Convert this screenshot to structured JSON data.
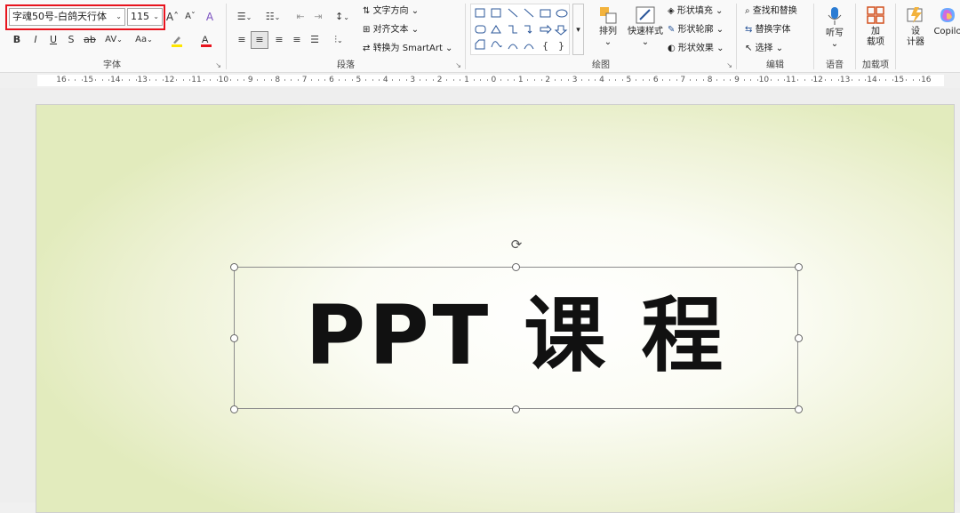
{
  "font": {
    "family_value": "字魂50号-白鸽天行体",
    "size_value": "115",
    "grow_icon": "Aˆ",
    "shrink_icon": "Aˇ",
    "clear_icon": "A",
    "bold": "B",
    "italic": "I",
    "underline": "U",
    "shadow": "S",
    "strike": "ab",
    "spacing": "AV",
    "case": "Aa",
    "highlight_color": "#ffe600",
    "font_color": "#e8141e",
    "label": "字体"
  },
  "paragraph": {
    "text_direction": "文字方向",
    "align_text": "对齐文本",
    "smartart": "转换为 SmartArt",
    "label": "段落"
  },
  "drawing": {
    "arrange": "排列",
    "quick_styles": "快速样式",
    "shape_fill": "形状填充",
    "shape_outline": "形状轮廓",
    "shape_effects": "形状效果",
    "label": "绘图"
  },
  "editing": {
    "find_replace": "查找和替换",
    "replace_font": "替换字体",
    "select": "选择",
    "label": "编辑"
  },
  "voice": {
    "dictate": "听写",
    "label": "语音"
  },
  "addins": {
    "addins": "加\n载项",
    "label": "加载项"
  },
  "designer": {
    "label": "设\n计器"
  },
  "copilot": {
    "label": "Copilo"
  },
  "ruler": {
    "ticks": [
      "16",
      "15",
      "14",
      "13",
      "12",
      "11",
      "10",
      "9",
      "8",
      "7",
      "6",
      "5",
      "4",
      "3",
      "2",
      "1",
      "0",
      "1",
      "2",
      "3",
      "4",
      "5",
      "6",
      "7",
      "8",
      "9",
      "10",
      "11",
      "12",
      "13",
      "14",
      "15",
      "16"
    ]
  },
  "slide": {
    "title": "PPT 课 程",
    "background_accent": "#e2ebbd"
  },
  "colors": {
    "highlight_border": "#e8141e"
  }
}
